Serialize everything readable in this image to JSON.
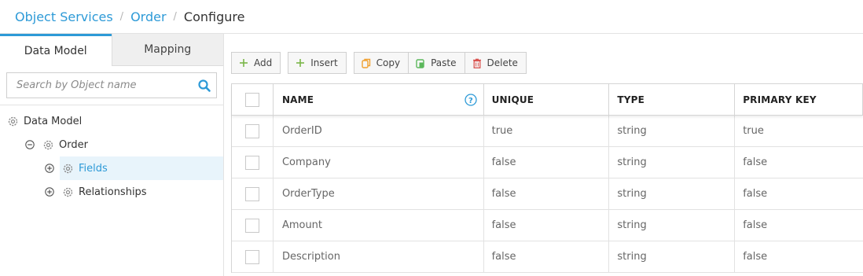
{
  "breadcrumb": {
    "items": [
      "Object Services",
      "Order"
    ],
    "current": "Configure",
    "separator": "/"
  },
  "tabs": [
    {
      "label": "Data Model",
      "active": true
    },
    {
      "label": "Mapping",
      "active": false
    }
  ],
  "search": {
    "placeholder": "Search by Object name",
    "value": "",
    "icon": "search-icon"
  },
  "tree": {
    "root": {
      "label": "Data Model",
      "icon": "gear-icon"
    },
    "order": {
      "label": "Order",
      "icon": "gear-icon",
      "toggle": "collapse-icon"
    },
    "fields": {
      "label": "Fields",
      "icon": "gear-icon",
      "toggle": "expand-icon",
      "selected": true
    },
    "relationships": {
      "label": "Relationships",
      "icon": "gear-icon",
      "toggle": "expand-icon"
    }
  },
  "toolbar": {
    "add": "Add",
    "insert": "Insert",
    "copy": "Copy",
    "paste": "Paste",
    "delete": "Delete"
  },
  "grid": {
    "columns": [
      "NAME",
      "UNIQUE",
      "TYPE",
      "PRIMARY KEY"
    ],
    "rows": [
      [
        "OrderID",
        "true",
        "string",
        "true"
      ],
      [
        "Company",
        "false",
        "string",
        "false"
      ],
      [
        "OrderType",
        "false",
        "string",
        "false"
      ],
      [
        "Amount",
        "false",
        "string",
        "false"
      ],
      [
        "Description",
        "false",
        "string",
        "false"
      ]
    ]
  },
  "colors": {
    "accent": "#2d9ad7",
    "add_icon": "#7ab648",
    "copy_icon": "#f0a030",
    "paste_icon": "#5cb85c",
    "delete_icon": "#d9534f"
  }
}
